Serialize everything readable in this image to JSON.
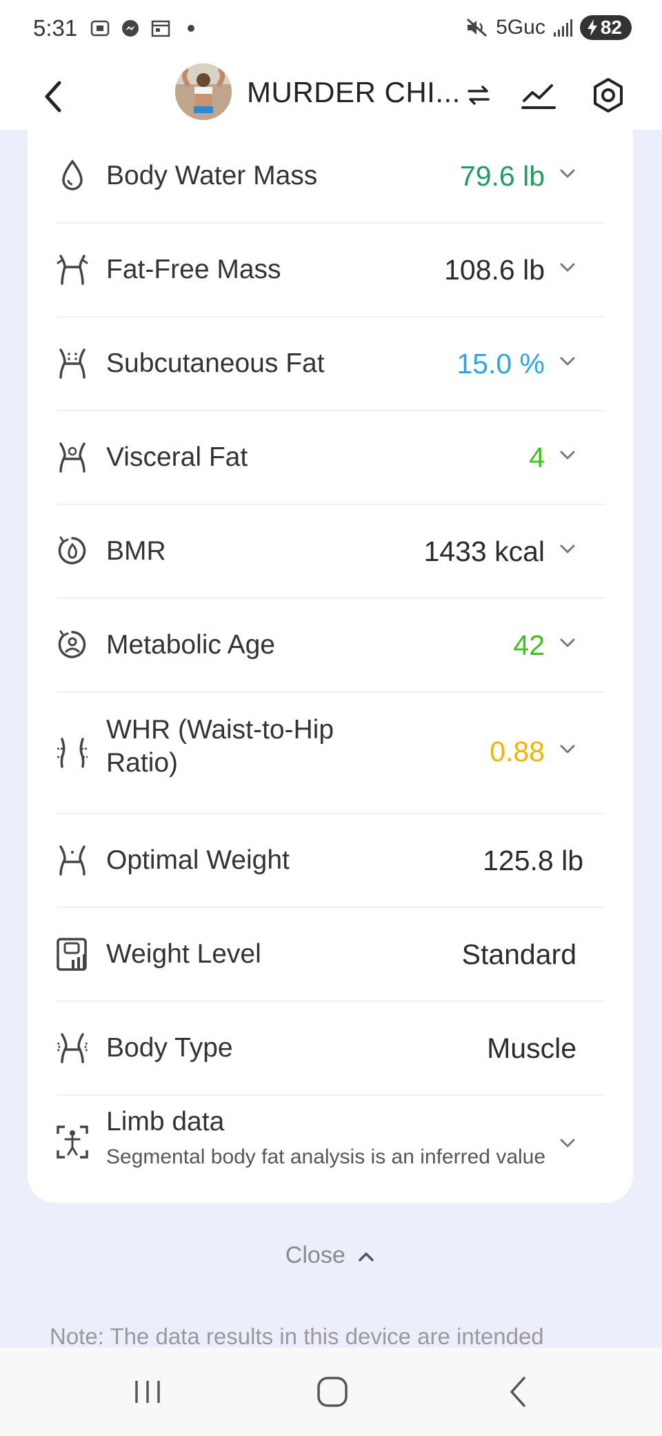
{
  "status_bar": {
    "time": "5:31",
    "network": "5Guc",
    "battery": "82"
  },
  "header": {
    "title": "MURDER CHI..."
  },
  "colors": {
    "green": "#1E9E5C",
    "teal_blue": "#2AA6E8",
    "bright_green": "#3EC31A",
    "amber": "#F2B400",
    "dark": "#2B2B2B"
  },
  "metrics": [
    {
      "label": "Body Water Mass",
      "value": "79.6 lb",
      "icon": "water-drop-icon"
    },
    {
      "label": "Fat-Free Mass",
      "value": "108.6 lb",
      "icon": "muscle-body-icon"
    },
    {
      "label": "Subcutaneous Fat",
      "value": "15.0 %",
      "icon": "subcutaneous-fat-icon"
    },
    {
      "label": "Visceral Fat",
      "value": "4",
      "icon": "visceral-fat-icon"
    },
    {
      "label": "BMR",
      "value": "1433 kcal",
      "icon": "bmr-icon"
    },
    {
      "label": "Metabolic Age",
      "value": "42",
      "icon": "metabolic-age-icon"
    },
    {
      "label": "WHR (Waist-to-Hip",
      "label_line2": "Ratio)",
      "value": "0.88",
      "icon": "waist-hip-icon"
    },
    {
      "label": "Optimal Weight",
      "value": "125.8 lb",
      "icon": "optimal-weight-icon"
    },
    {
      "label": "Weight Level",
      "value": "Standard",
      "icon": "weight-level-icon"
    },
    {
      "label": "Body Type",
      "value": "Muscle",
      "icon": "body-type-icon"
    },
    {
      "label": "Limb data",
      "subtitle": "Segmental body fat analysis is an inferred value",
      "icon": "limb-data-icon"
    }
  ],
  "close_label": "Close",
  "note": "Note: The data results in this device are intended"
}
